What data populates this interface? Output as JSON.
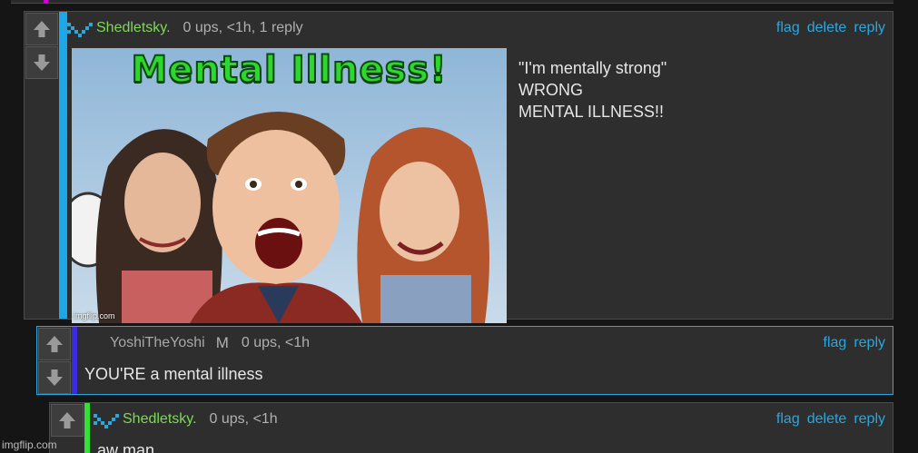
{
  "comments": [
    {
      "username": "Shedletsky.",
      "meta": "0 ups, <1h, 1 reply",
      "actions": [
        "flag",
        "delete",
        "reply"
      ],
      "text_lines": [
        "\"I'm mentally strong\"",
        "WRONG",
        "MENTAL ILLNESS!!"
      ],
      "image": {
        "title": "Mental Illness!",
        "watermark": "imgflip.com"
      },
      "bar_color": "#1ea7e8"
    },
    {
      "username": "YoshiTheYoshi",
      "badge": "M",
      "meta": "0 ups, <1h",
      "actions": [
        "flag",
        "reply"
      ],
      "text": "YOU'RE a mental illness",
      "bar_color": "#3b2be0"
    },
    {
      "username": "Shedletsky.",
      "meta": "0 ups, <1h",
      "actions": [
        "flag",
        "delete",
        "reply"
      ],
      "text": "aw man",
      "bar_color": "#33e033"
    }
  ],
  "page_watermark": "imgflip.com",
  "colors": {
    "link": "#29a8e0",
    "username_green": "#7ed957",
    "top_accent": "#d000d0"
  },
  "icons": {
    "up": "arrow-up-icon",
    "down": "arrow-down-icon",
    "user": "pixel-user-icon"
  }
}
